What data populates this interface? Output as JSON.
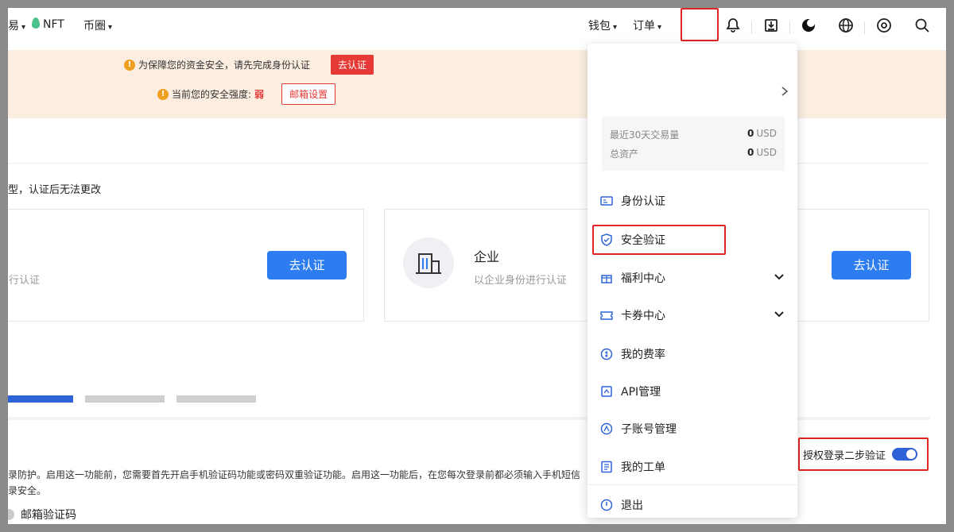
{
  "nav": {
    "trade_partial": "易",
    "nft": "NFT",
    "coin_circle": "币圈",
    "wallet": "钱包",
    "orders": "订单",
    "caret": "▾"
  },
  "banner": {
    "warn_identity": "为保障您的资金安全，请先完成身份认证",
    "btn_verify": "去认证",
    "security_prefix": "当前您的安全强度:",
    "security_level": "弱",
    "btn_email": "邮箱设置"
  },
  "main": {
    "notice": "型，认证后无法更改",
    "personal_card": {
      "sub_partial": "行认证",
      "button": "去认证"
    },
    "enterprise_card": {
      "title": "企业",
      "sub": "以企业身份进行认证",
      "button": "去认证"
    },
    "section_text_1": "录防护。启用这一功能前，您需要首先开启手机验证码功能或密码双重验证功能。启用这一功能后，在您每次登录前都必须输入手机短信",
    "section_text_2": "录安全。",
    "email_code": "邮箱验证码",
    "toggle_label": "授权登录二步验证",
    "toggle_on": true
  },
  "dropdown": {
    "stats": [
      {
        "label": "最近30天交易量",
        "value": "0",
        "unit": "USD"
      },
      {
        "label": "总资产",
        "value": "0",
        "unit": "USD"
      }
    ],
    "items": [
      {
        "label": "身份认证"
      },
      {
        "label": "安全验证"
      },
      {
        "label": "福利中心"
      },
      {
        "label": "卡券中心"
      },
      {
        "label": "我的费率"
      },
      {
        "label": "API管理"
      },
      {
        "label": "子账号管理"
      },
      {
        "label": "我的工单"
      }
    ],
    "logout": "退出"
  },
  "colors": {
    "accent_blue": "#2d7df0",
    "alert_red": "#e63a36",
    "banner_bg": "#fbeee0",
    "highlight_red": "#e02424"
  }
}
